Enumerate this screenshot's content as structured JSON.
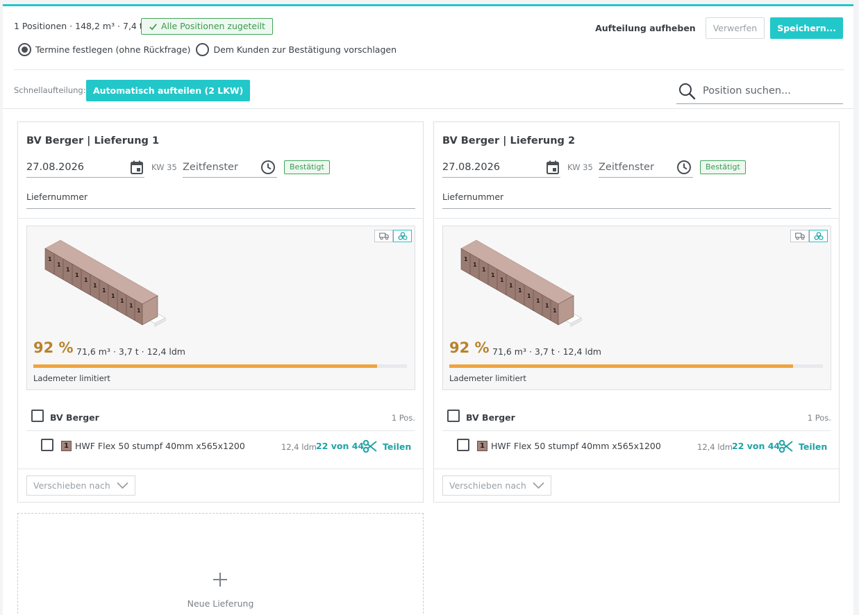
{
  "header": {
    "summary": "1 Positionen · 148,2 m³ · 7,4 t",
    "all_assigned_badge": "Alle Positionen zugeteilt",
    "radio_options": [
      {
        "label": "Termine festlegen (ohne Rückfrage)",
        "checked": true
      },
      {
        "label": "Dem Kunden zur Bestätigung vorschlagen",
        "checked": false
      }
    ],
    "actions": {
      "undo_split": "Aufteilung aufheben",
      "discard": "Verwerfen",
      "save": "Speichern..."
    }
  },
  "quick_split": {
    "label": "Schnellaufteilung:",
    "auto_button": "Automatisch aufteilen (2 LKW)",
    "search_placeholder": "Position suchen..."
  },
  "deliveries": [
    {
      "title": "BV Berger | Lieferung 1",
      "date": "27.08.2026",
      "kw": "KW 35",
      "time_placeholder": "Zeitfenster",
      "status": "Bestätigt",
      "lief_label": "Liefernummer",
      "view_toggle": {
        "options": [
          "truck-icon",
          "pallets-icon"
        ],
        "active": "pallets-icon"
      },
      "utilization_pct": "92 %",
      "utilization_fraction": 0.92,
      "metrics": "71,6 m³ · 3,7 t · 12,4 ldm",
      "limit_note": "Lademeter limitiert",
      "group": {
        "name": "BV Berger",
        "count": "1 Pos."
      },
      "items": [
        {
          "chip": "1",
          "name": "HWF Flex 50 stumpf 40mm x565x1200",
          "ldm": "12,4 ldm",
          "qty": "22 von 44",
          "split_label": "Teilen"
        }
      ],
      "move_label": "Verschieben nach"
    },
    {
      "title": "BV Berger | Lieferung 2",
      "date": "27.08.2026",
      "kw": "KW 35",
      "time_placeholder": "Zeitfenster",
      "status": "Bestätigt",
      "lief_label": "Liefernummer",
      "view_toggle": {
        "options": [
          "truck-icon",
          "pallets-icon"
        ],
        "active": "pallets-icon"
      },
      "utilization_pct": "92 %",
      "utilization_fraction": 0.92,
      "metrics": "71,6 m³ · 3,7 t · 12,4 ldm",
      "limit_note": "Lademeter limitiert",
      "group": {
        "name": "BV Berger",
        "count": "1 Pos."
      },
      "items": [
        {
          "chip": "1",
          "name": "HWF Flex 50 stumpf 40mm x565x1200",
          "ldm": "12,4 ldm",
          "qty": "22 von 44",
          "split_label": "Teilen"
        }
      ],
      "move_label": "Verschieben nach"
    }
  ],
  "new_delivery": {
    "label": "Neue Lieferung"
  },
  "colors": {
    "accent": "#22c7c9",
    "accent_text": "#1fa3a5",
    "success": "#3b9a52",
    "utilization": "#b8832a",
    "bar": "#f0a43c",
    "pallet": "#a4857c"
  }
}
